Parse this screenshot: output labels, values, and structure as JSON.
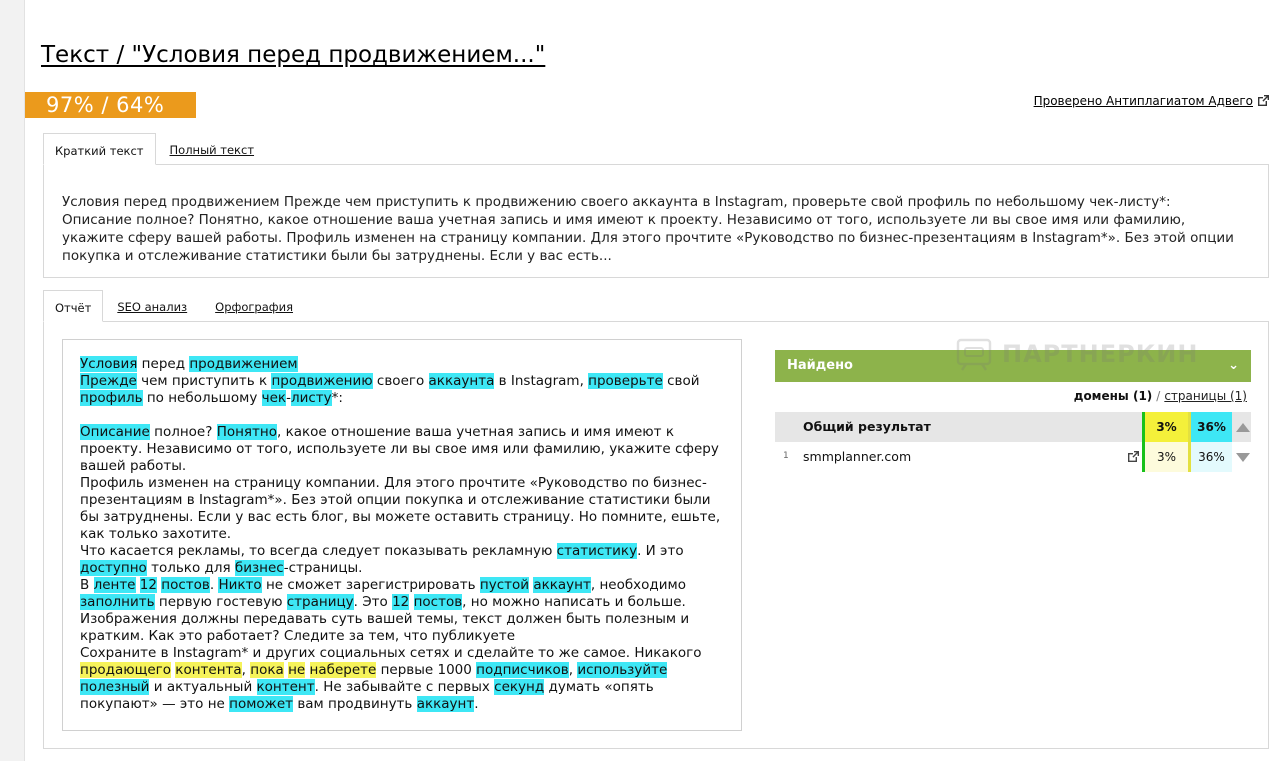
{
  "header": {
    "title": "Текст / \"Условия перед продвижением...\"",
    "score": "97% / 64%",
    "checked_link": "Проверено Антиплагиатом Адвего"
  },
  "text_tabs": [
    {
      "label": "Краткий текст",
      "active": true
    },
    {
      "label": "Полный текст",
      "active": false
    }
  ],
  "summary_text": "Условия перед продвижением Прежде чем приступить к продвижению своего аккаунта в Instagram, проверьте свой профиль по небольшому чек-листу*: Описание полное? Понятно, какое отношение ваша учетная запись и имя имеют к проекту. Независимо от того, используете ли вы свое имя или фамилию, укажите сферу вашей работы. Профиль изменен на страницу компании. Для этого прочтите «Руководство по бизнес-презентациям в Instagram*». Без этой опции покупка и отслеживание статистики были бы затруднены. Если у вас есть...",
  "report_tabs": [
    {
      "label": "Отчёт",
      "active": true
    },
    {
      "label": "SEO анализ",
      "active": false
    },
    {
      "label": "Орфография",
      "active": false
    }
  ],
  "report_paragraphs": [
    [
      [
        "Условия",
        "c"
      ],
      [
        " перед ",
        ""
      ],
      [
        "продвижением",
        "c"
      ]
    ],
    [
      [
        "Прежде",
        "c"
      ],
      [
        " чем приступить к ",
        ""
      ],
      [
        "продвижению",
        "c"
      ],
      [
        " своего ",
        ""
      ],
      [
        "аккаунта",
        "c"
      ],
      [
        " в Instagram, ",
        ""
      ],
      [
        "проверьте",
        "c"
      ],
      [
        " свой ",
        ""
      ],
      [
        "профиль",
        "c"
      ],
      [
        " по небольшому ",
        ""
      ],
      [
        "чек",
        "c"
      ],
      [
        "-",
        ""
      ],
      [
        "листу",
        "c"
      ],
      [
        "*:",
        ""
      ]
    ],
    [
      [
        " ",
        ""
      ]
    ],
    [
      [
        "Описание",
        "c"
      ],
      [
        " полное? ",
        ""
      ],
      [
        "Понятно",
        "c"
      ],
      [
        ", какое отношение ваша учетная запись и имя имеют к проекту. Независимо от того, используете ли вы свое имя или фамилию, укажите сферу вашей работы.",
        ""
      ]
    ],
    [
      [
        "Профиль изменен на страницу компании. Для этого прочтите «Руководство по бизнес-презентациям в Instagram*». Без этой опции покупка и отслеживание статистики были бы затруднены. Если у вас есть блог, вы можете оставить страницу. Но помните, ешьте, как только захотите.",
        ""
      ]
    ],
    [
      [
        "Что касается рекламы, то всегда следует показывать рекламную ",
        ""
      ],
      [
        "статистику",
        "c"
      ],
      [
        ". И это ",
        ""
      ],
      [
        "доступно",
        "c"
      ],
      [
        " только для ",
        ""
      ],
      [
        "бизнес",
        "c"
      ],
      [
        "-страницы.",
        ""
      ]
    ],
    [
      [
        "В ",
        ""
      ],
      [
        "ленте",
        "c"
      ],
      [
        " ",
        ""
      ],
      [
        "12",
        "c"
      ],
      [
        " ",
        ""
      ],
      [
        "постов",
        "c"
      ],
      [
        ". ",
        ""
      ],
      [
        "Никто",
        "c"
      ],
      [
        " не сможет зарегистрировать ",
        ""
      ],
      [
        "пустой",
        "c"
      ],
      [
        " ",
        ""
      ],
      [
        "аккаунт",
        "c"
      ],
      [
        ", необходимо ",
        ""
      ],
      [
        "заполнить",
        "c"
      ],
      [
        " первую гостевую ",
        ""
      ],
      [
        "страницу",
        "c"
      ],
      [
        ". Это ",
        ""
      ],
      [
        "12",
        "c"
      ],
      [
        " ",
        ""
      ],
      [
        "постов",
        "c"
      ],
      [
        ", но можно написать и больше. Изображения должны передавать суть вашей темы, текст должен быть полезным и кратким. Как это работает? Следите за тем, что публикуете",
        ""
      ]
    ],
    [
      [
        "Сохраните в Instagram* и других социальных сетях и сделайте то же самое. Никакого ",
        ""
      ],
      [
        "продающего",
        "y"
      ],
      [
        " ",
        ""
      ],
      [
        "контента",
        "y"
      ],
      [
        ", ",
        ""
      ],
      [
        "пока",
        "y"
      ],
      [
        " ",
        ""
      ],
      [
        "не",
        "y"
      ],
      [
        " ",
        ""
      ],
      [
        "наберете",
        "y"
      ],
      [
        " первые 1000 ",
        ""
      ],
      [
        "подписчиков",
        "c"
      ],
      [
        ", ",
        ""
      ],
      [
        "используйте",
        "c"
      ],
      [
        " ",
        ""
      ],
      [
        "полезный",
        "c"
      ],
      [
        " и актуальный ",
        ""
      ],
      [
        "контент",
        "c"
      ],
      [
        ". Не забывайте с первых ",
        ""
      ],
      [
        "секунд",
        "c"
      ],
      [
        " думать «опять покупают» — это не ",
        ""
      ],
      [
        "поможет",
        "c"
      ],
      [
        " вам продвинуть ",
        ""
      ],
      [
        "аккаунт",
        "c"
      ],
      [
        ".",
        ""
      ]
    ]
  ],
  "found": {
    "title": "Найдено",
    "domains_label": "домены (1)",
    "separator": "/",
    "pages_label": "страницы (1)",
    "total_label": "Общий результат",
    "total_col1": "3%",
    "total_col2": "36%",
    "rows": [
      {
        "index": "1",
        "domain": "smmplanner.com",
        "col1": "3%",
        "col2": "36%"
      }
    ]
  },
  "watermark": "ПАРТНЕРКИН",
  "colors": {
    "score_bg": "#eb9a1c",
    "found_header": "#8db34b",
    "highlight_cyan": "#3ee7f5",
    "highlight_yellow": "#f6f35a"
  }
}
